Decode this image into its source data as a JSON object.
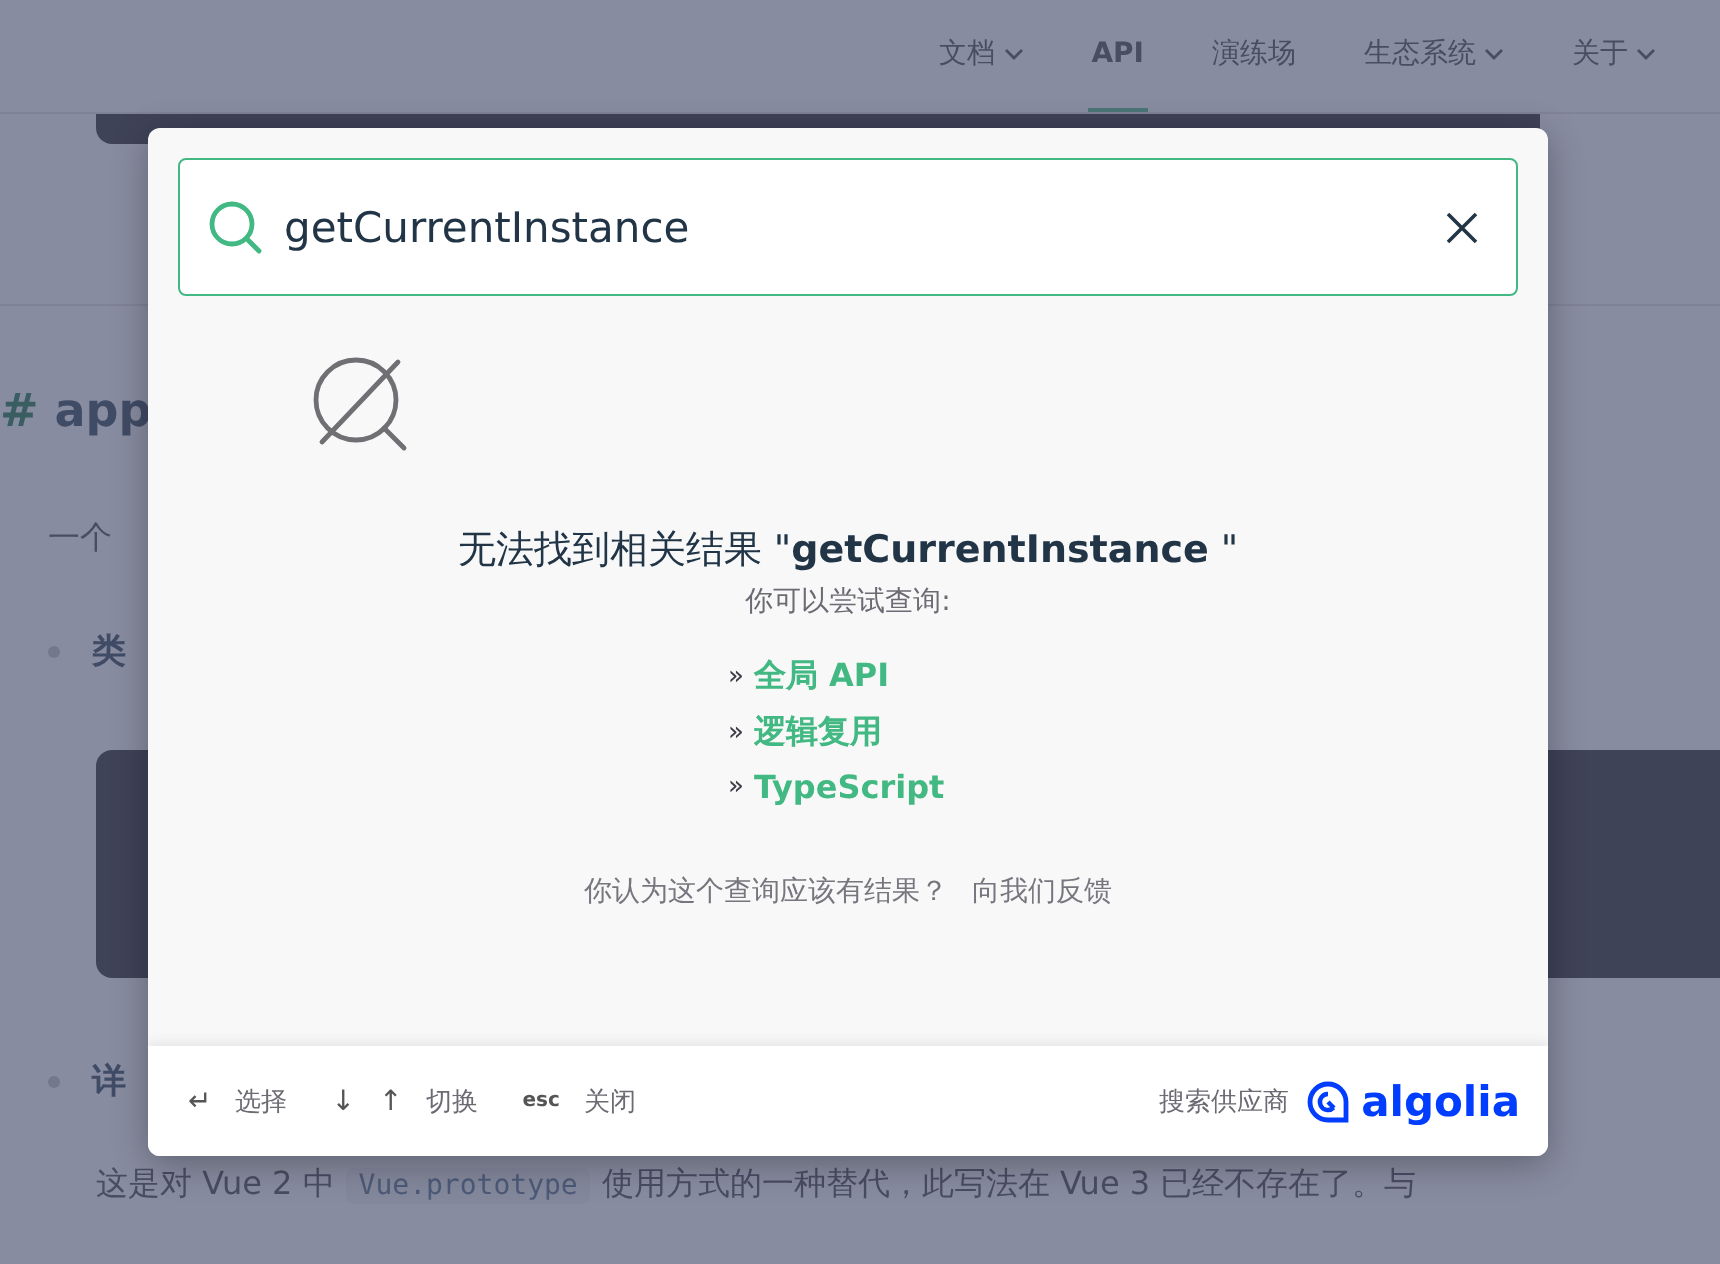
{
  "nav": [
    {
      "label": "文档",
      "dropdown": true,
      "selected": false
    },
    {
      "label": "API",
      "dropdown": false,
      "selected": true
    },
    {
      "label": "演练场",
      "dropdown": false,
      "selected": false
    },
    {
      "label": "生态系统",
      "dropdown": true,
      "selected": false
    },
    {
      "label": "关于",
      "dropdown": true,
      "selected": false
    }
  ],
  "page": {
    "heading_mark": "#",
    "heading": "app",
    "intro": "一个",
    "bullets": [
      "类",
      "详"
    ],
    "paragraph": [
      {
        "kind": "text",
        "text": "这是对 Vue 2 中"
      },
      {
        "kind": "code",
        "text": "Vue.prototype"
      },
      {
        "kind": "text",
        "text": "使用方式的一种替代，此写法在 Vue 3 已经不存在了。与"
      }
    ]
  },
  "search": {
    "value": "getCurrentInstance"
  },
  "no_results": {
    "message": "无法找到相关结果 \"**getCurrentInstance** \"",
    "hint": "你可以尝试查询:",
    "suggestions": [
      {
        "marker": "»",
        "label": "全局 API"
      },
      {
        "marker": "»",
        "label": "逻辑复用"
      },
      {
        "marker": "»",
        "label": "TypeScript"
      }
    ],
    "feedback": "你认为这个查询应该有结果？",
    "feedback_link": "向我们反馈"
  },
  "footer": {
    "commands": [
      {
        "keys": [
          "↵"
        ],
        "label": "选择"
      },
      {
        "keys": [
          "↓",
          "↑"
        ],
        "label": "切换"
      },
      {
        "keys": [
          "esc"
        ],
        "label": "关闭"
      }
    ],
    "provider_label": "搜索供应商",
    "provider": "algolia"
  }
}
